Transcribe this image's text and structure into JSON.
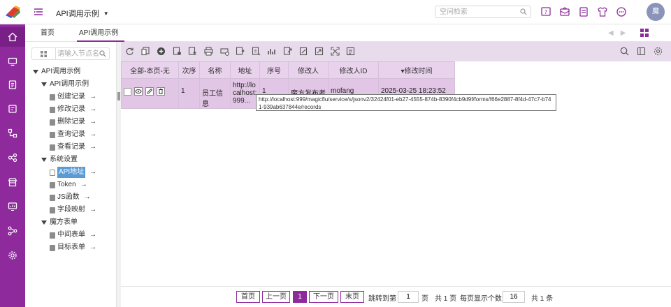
{
  "header": {
    "app_title": "API调用示例",
    "search_placeholder": "空间检索",
    "avatar_text": "魔",
    "icons": [
      "help-icon",
      "mail-icon",
      "list-icon",
      "shirt-icon",
      "more-icon"
    ]
  },
  "rail": {
    "icons": [
      "home-icon",
      "monitor-icon",
      "clipboard-icon",
      "document-icon",
      "flow-icon",
      "share-icon",
      "store-icon",
      "screen-icon",
      "network-icon",
      "settings-icon"
    ]
  },
  "tabs": [
    {
      "label": "首页"
    },
    {
      "label": "API调用示例"
    }
  ],
  "sidebar": {
    "search_placeholder": "请输入节点名",
    "tree": [
      {
        "label": "API调用示例"
      },
      {
        "label": "API调用示例"
      },
      {
        "label": "创建记录"
      },
      {
        "label": "修改记录"
      },
      {
        "label": "删除记录"
      },
      {
        "label": "查询记录"
      },
      {
        "label": "查看记录"
      },
      {
        "label": "系统设置"
      },
      {
        "label": "API地址"
      },
      {
        "label": "Token"
      },
      {
        "label": "JS函数"
      },
      {
        "label": "字段映射"
      },
      {
        "label": "魔方表单"
      },
      {
        "label": "中间表单"
      },
      {
        "label": "目标表单"
      }
    ],
    "arrow": "→"
  },
  "table": {
    "headers": [
      "全部-本页-无",
      "次序",
      "名称",
      "地址",
      "序号",
      "修改人",
      "修改人ID",
      "▾修改时间"
    ],
    "rows": [
      {
        "order": "1",
        "name": "员工信息",
        "address": "http://localhost:999...",
        "seq": "1",
        "modifier": "魔方发布者",
        "modifier_id": "mofang",
        "modified_time": "2025-03-25 18:23:52"
      }
    ]
  },
  "tooltip": "http://localhost:999/magicflu/service/s/jsonv2/32424f01-eb27-4555-874b-8390f4cb9d9f/forms/f66e2887-8f4d-47c7-b741-939ab637844e/records",
  "pager": {
    "first": "首页",
    "prev": "上一页",
    "current": "1",
    "next": "下一页",
    "last": "末页",
    "jump_label": "跳转到第",
    "jump_value": "1",
    "page_unit": "页",
    "total_pages": "共 1 页",
    "per_page_label": "每页显示个数:",
    "per_page_value": "16",
    "total_items": "共 1 条"
  },
  "colors": {
    "accent": "#8e2a9c",
    "row_bg": "#e2c6e6",
    "toolbar_bg": "#e8dcec"
  }
}
